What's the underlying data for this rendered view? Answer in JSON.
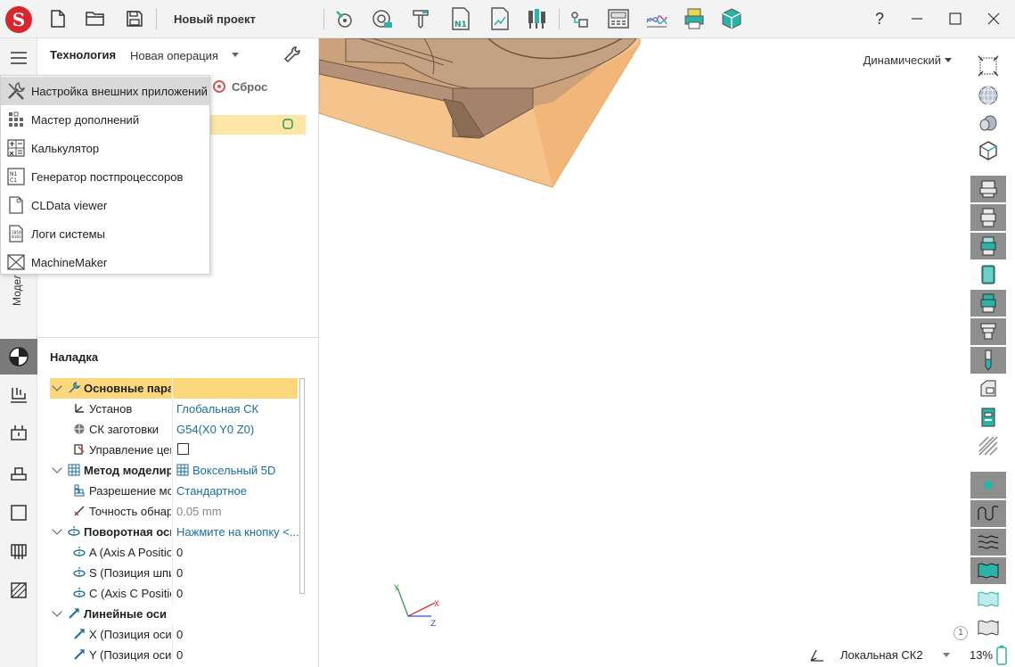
{
  "titlebar": {
    "project_name": "Новый проект",
    "help_label": "?",
    "icons": [
      "new-file-icon",
      "open-folder-icon",
      "save-icon",
      "magnet-tool-icon",
      "camera-tool-icon",
      "spindle-icon",
      "nc-program-icon",
      "report-icon",
      "tool-library-icon",
      "postprocessor-icon",
      "machine-control-icon",
      "curve-icon",
      "printer-icon",
      "package-icon"
    ]
  },
  "tech_panel": {
    "title": "Технология",
    "new_operation": "Новая операция",
    "reset_label": "Сброс"
  },
  "left_rail": {
    "vertical_tab": "Модель"
  },
  "ext_menu": {
    "items": [
      {
        "label": "Настройка внешних приложений",
        "icon": "tools-icon"
      },
      {
        "label": "Мастер дополнений",
        "icon": "addons-grid-icon"
      },
      {
        "label": "Калькулятор",
        "icon": "calculator-icon"
      },
      {
        "label": "Генератор постпроцессоров",
        "icon": "postprocessor-generator-icon"
      },
      {
        "label": "CLData viewer",
        "icon": "cldata-file-icon"
      },
      {
        "label": "Логи системы",
        "icon": "logs-file-icon"
      },
      {
        "label": "MachineMaker",
        "icon": "machinemaker-icon"
      }
    ]
  },
  "setup_panel": {
    "title": "Наладка",
    "rows": [
      {
        "name": "Основные парам",
        "value": "",
        "bold": true,
        "caret": true,
        "indent": 0
      },
      {
        "name": "Установ",
        "value": "Глобальная СК",
        "indent": 1
      },
      {
        "name": "СК заготовки",
        "value": "G54(X0 Y0 Z0)",
        "indent": 1
      },
      {
        "name": "Управление цен",
        "value": "",
        "checkbox": true,
        "indent": 1
      },
      {
        "name": "Метод моделир",
        "value": "Воксельный 5D",
        "bold": true,
        "caret": true,
        "indent": 0
      },
      {
        "name": "Разрешение мо",
        "value": "Стандартное",
        "indent": 1
      },
      {
        "name": "Точность обнар",
        "value": "0.05 mm",
        "indent": 1
      },
      {
        "name": "Поворотная ось",
        "value": "Нажмите на кнопку <...",
        "bold": true,
        "caret": true,
        "indent": 0
      },
      {
        "name": "A (Axis A Positio",
        "value": "0",
        "indent": 1
      },
      {
        "name": "S (Позиция шпи",
        "value": "0",
        "indent": 1
      },
      {
        "name": "C (Axis C Positio",
        "value": "0",
        "indent": 1
      },
      {
        "name": "Линейные оси",
        "value": "",
        "bold": true,
        "caret": true,
        "indent": 0
      },
      {
        "name": "X (Позиция оси",
        "value": "0",
        "indent": 1
      },
      {
        "name": "Y (Позиция оси",
        "value": "0",
        "indent": 1
      }
    ]
  },
  "viewport": {
    "view_mode": "Динамический",
    "coord_system": "Локальная СК2",
    "axis_labels": {
      "x": "X",
      "y": "Y",
      "z": "Z"
    }
  },
  "right_rail": {
    "zoom": "13%",
    "badge": "1"
  },
  "colors": {
    "highlight": "#fdd77c",
    "selection": "#fde6a6",
    "teal": "#2bb3a8",
    "brand_red": "#d8262e"
  }
}
